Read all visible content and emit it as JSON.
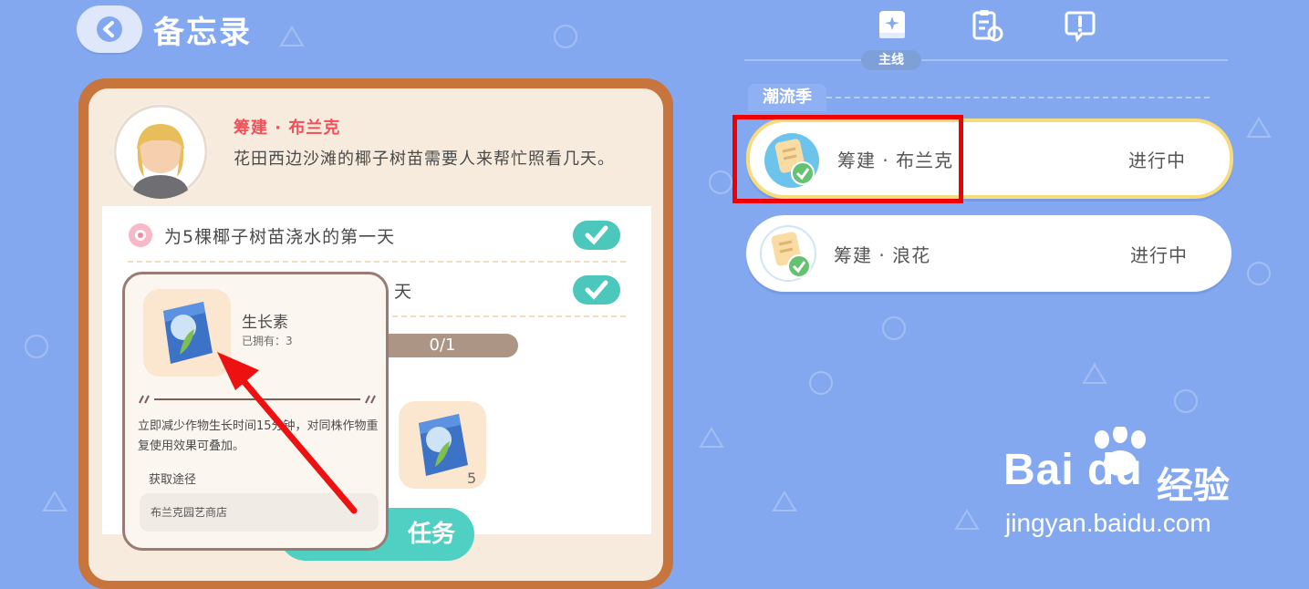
{
  "header": {
    "title": "备忘录"
  },
  "tabs": {
    "active_label": "主线",
    "icons": [
      "book-star-icon",
      "clipboard-refresh-icon",
      "chat-exclaim-icon"
    ]
  },
  "section": {
    "label": "潮流季"
  },
  "quests": [
    {
      "name": "筹建 · 布兰克",
      "status": "进行中"
    },
    {
      "name": "筹建 · 浪花",
      "status": "进行中"
    }
  ],
  "detail": {
    "npc_name": "筹建 · 布兰克",
    "description": "花田西边沙滩的椰子树苗需要人来帮忙照看几天。",
    "tasks": [
      {
        "text": "为5棵椰子树苗浇水的第一天",
        "done": true
      },
      {
        "text": "天",
        "done": true
      },
      {
        "text": "天",
        "progress": "0/1"
      }
    ],
    "reward_count": "5",
    "action_label": "任务"
  },
  "tooltip": {
    "item_name": "生长素",
    "owned": "已拥有：3",
    "description": "立即减少作物生长时间15分钟，对同株作物重复使用效果可叠加。",
    "source_title": "获取途径",
    "source_item": "布兰克园艺商店"
  },
  "watermark": {
    "logo_text": "Bai du",
    "cn": "经验",
    "url": "jingyan.baidu.com"
  },
  "colors": {
    "background": "#84a8f0",
    "accent_teal": "#4cc7bb",
    "highlight": "#ee0000",
    "npc_name": "#f0505a"
  }
}
